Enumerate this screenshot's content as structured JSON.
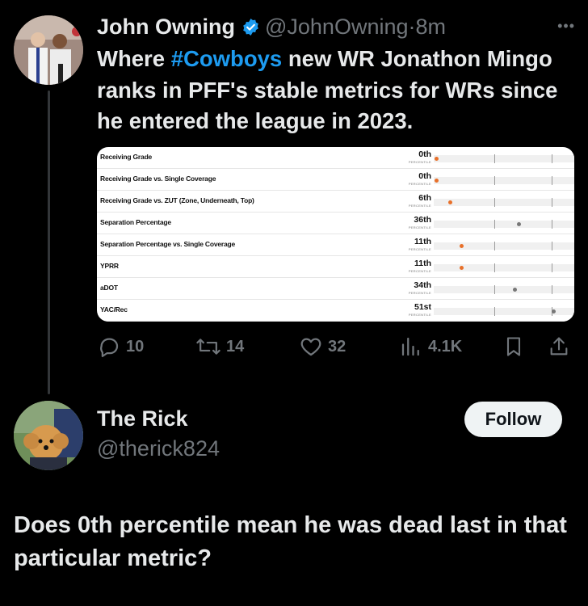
{
  "post": {
    "author_name": "John Owning",
    "handle": "@JohnOwning",
    "time": "8m",
    "text_before": "Where ",
    "hashtag": "#Cowboys",
    "text_after": " new WR Jonathon Mingo ranks in PFF's stable metrics for WRs since he entered the league in 2023.",
    "more_icon": "ellipsis-icon",
    "colors": {
      "accent": "#1d9bf0",
      "muted": "#71767b",
      "background": "#000000"
    }
  },
  "chart_data": {
    "type": "table",
    "rows": [
      {
        "label": "Receiving Grade",
        "percentile": 0,
        "display": "0th",
        "sub": "PERCENTILE",
        "color": "#e8702a"
      },
      {
        "label": "Receiving Grade vs. Single Coverage",
        "percentile": 0,
        "display": "0th",
        "sub": "PERCENTILE",
        "color": "#e8702a"
      },
      {
        "label": "Receiving Grade vs. ZUT (Zone, Underneath, Top)",
        "percentile": 6,
        "display": "6th",
        "sub": "PERCENTILE",
        "color": "#e8702a"
      },
      {
        "label": "Separation Percentage",
        "percentile": 36,
        "display": "36th",
        "sub": "PERCENTILE",
        "color": "#777777"
      },
      {
        "label": "Separation Percentage vs. Single Coverage",
        "percentile": 11,
        "display": "11th",
        "sub": "PERCENTILE",
        "color": "#e8702a"
      },
      {
        "label": "YPRR",
        "percentile": 11,
        "display": "11th",
        "sub": "PERCENTILE",
        "color": "#e8702a"
      },
      {
        "label": "aDOT",
        "percentile": 34,
        "display": "34th",
        "sub": "PERCENTILE",
        "color": "#777777"
      },
      {
        "label": "YAC/Rec",
        "percentile": 51,
        "display": "51st",
        "sub": "PERCENTILE",
        "color": "#777777"
      }
    ],
    "xlim": [
      0,
      100
    ],
    "ticks": [
      25,
      50,
      75
    ]
  },
  "actions": {
    "reply": {
      "icon": "reply-icon",
      "count": "10"
    },
    "repost": {
      "icon": "repost-icon",
      "count": "14"
    },
    "like": {
      "icon": "heart-icon",
      "count": "32"
    },
    "views": {
      "icon": "views-icon",
      "count": "4.1K"
    },
    "bookmark": {
      "icon": "bookmark-icon"
    },
    "share": {
      "icon": "share-icon"
    }
  },
  "reply_user": {
    "name": "The Rick",
    "handle": "@therick824",
    "follow_label": "Follow"
  },
  "reply": {
    "text": "Does 0th percentile mean he was dead last in that particular metric?"
  }
}
